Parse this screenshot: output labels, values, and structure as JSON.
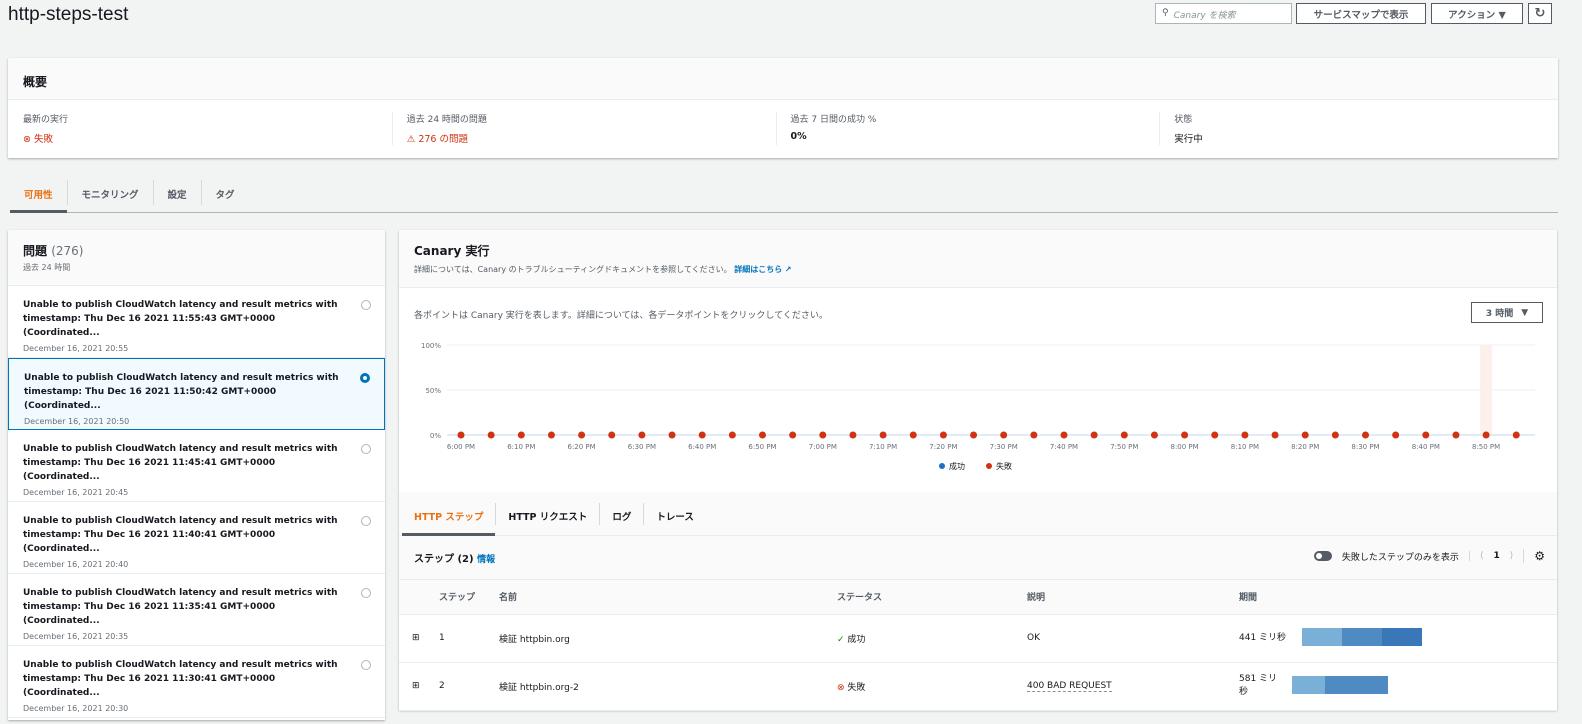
{
  "header": {
    "title": "http-steps-test",
    "search_placeholder": "Canary を検索",
    "service_map_button": "サービスマップで表示",
    "actions_button": "アクション ▼",
    "refresh_icon": "refresh-icon"
  },
  "summary": {
    "title": "概要",
    "cols": [
      {
        "label": "最新の実行",
        "value": "失敗"
      },
      {
        "label": "過去 24 時間の問題",
        "value": "276 の問題"
      },
      {
        "label": "過去 7 日間の成功 %",
        "value": "0%"
      },
      {
        "label": "状態",
        "value": "実行中"
      }
    ]
  },
  "tabs": [
    "可用性",
    "モニタリング",
    "設定",
    "タグ"
  ],
  "issues": {
    "title": "問題",
    "count": "(276)",
    "subtitle": "過去 24 時間",
    "items": [
      {
        "text": "Unable to publish CloudWatch latency and result metrics with timestamp: Thu Dec 16 2021 11:55:43 GMT+0000 (Coordinated...",
        "date": "December 16, 2021 20:55"
      },
      {
        "text": "Unable to publish CloudWatch latency and result metrics with timestamp: Thu Dec 16 2021 11:50:42 GMT+0000 (Coordinated...",
        "date": "December 16, 2021 20:50"
      },
      {
        "text": "Unable to publish CloudWatch latency and result metrics with timestamp: Thu Dec 16 2021 11:45:41 GMT+0000 (Coordinated...",
        "date": "December 16, 2021 20:45"
      },
      {
        "text": "Unable to publish CloudWatch latency and result metrics with timestamp: Thu Dec 16 2021 11:40:41 GMT+0000 (Coordinated...",
        "date": "December 16, 2021 20:40"
      },
      {
        "text": "Unable to publish CloudWatch latency and result metrics with timestamp: Thu Dec 16 2021 11:35:41 GMT+0000 (Coordinated...",
        "date": "December 16, 2021 20:35"
      },
      {
        "text": "Unable to publish CloudWatch latency and result metrics with timestamp: Thu Dec 16 2021 11:30:41 GMT+0000 (Coordinated...",
        "date": "December 16, 2021 20:30"
      }
    ]
  },
  "canary": {
    "title": "Canary 実行",
    "desc": "詳細については、Canary のトラブルシューティングドキュメントを参照してください。",
    "link": "詳細はこちら",
    "hint": "各ポイントは Canary 実行を表します。詳細については、各データポイントをクリックしてください。",
    "range": "3 時間"
  },
  "chart_data": {
    "type": "scatter",
    "ylim": [
      0,
      100
    ],
    "yticks": [
      "100%",
      "50%",
      "0%"
    ],
    "xticks": [
      "6:00 PM",
      "6:10 PM",
      "6:20 PM",
      "6:30 PM",
      "6:40 PM",
      "6:50 PM",
      "7:00 PM",
      "7:10 PM",
      "7:20 PM",
      "7:30 PM",
      "7:40 PM",
      "7:50 PM",
      "8:00 PM",
      "8:10 PM",
      "8:20 PM",
      "8:30 PM",
      "8:40 PM",
      "8:50 PM"
    ],
    "x_minutes_from_6pm": [
      0,
      5,
      10,
      15,
      20,
      25,
      30,
      35,
      40,
      45,
      50,
      55,
      60,
      65,
      70,
      75,
      80,
      85,
      90,
      95,
      100,
      105,
      110,
      115,
      120,
      125,
      130,
      135,
      140,
      145,
      150,
      155,
      160,
      165,
      170,
      175
    ],
    "values": [
      0,
      0,
      0,
      0,
      0,
      0,
      0,
      0,
      0,
      0,
      0,
      0,
      0,
      0,
      0,
      0,
      0,
      0,
      0,
      0,
      0,
      0,
      0,
      0,
      0,
      0,
      0,
      0,
      0,
      0,
      0,
      0,
      0,
      0,
      0,
      0
    ],
    "status": "fail",
    "highlight_minute": 170,
    "legend": [
      {
        "label": "成功",
        "color": "#1f6fc2"
      },
      {
        "label": "失敗",
        "color": "#d13212"
      }
    ]
  },
  "subtabs": [
    "HTTP ステップ",
    "HTTP リクエスト",
    "ログ",
    "トレース"
  ],
  "steps": {
    "title": "ステップ (2)",
    "info": "情報",
    "toggle_label": "失敗したステップのみを表示",
    "page": "1",
    "columns": [
      "ステップ",
      "名前",
      "ステータス",
      "説明",
      "期間"
    ],
    "rows": [
      {
        "step": "1",
        "name": "検証 httpbin.org",
        "status": "成功",
        "desc": "OK",
        "duration": "441 ミリ秒"
      },
      {
        "step": "2",
        "name": "検証 httpbin.org-2",
        "status": "失敗",
        "desc": "400 BAD REQUEST",
        "duration": "581 ミリ秒"
      }
    ]
  }
}
